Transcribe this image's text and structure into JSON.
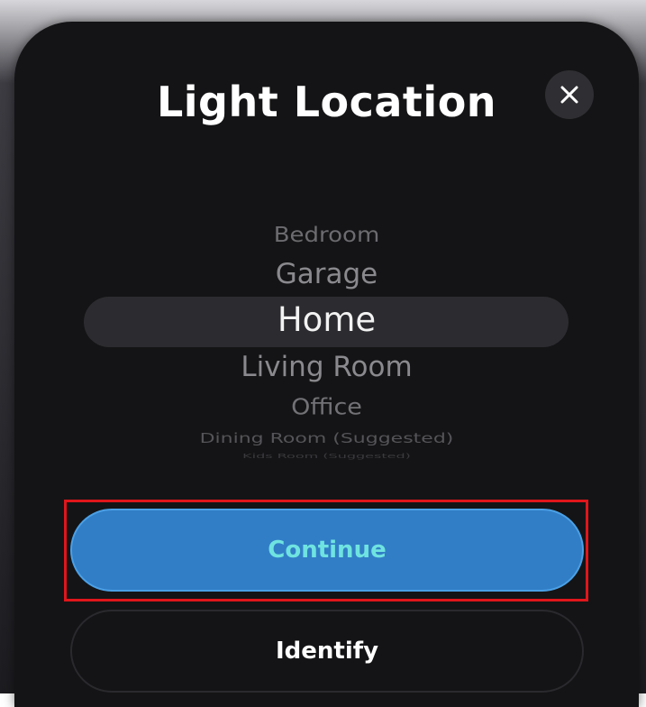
{
  "dialog": {
    "title": "Light Location",
    "close_icon": "close-icon"
  },
  "picker": {
    "items": [
      "Bedroom",
      "Garage",
      "Home",
      "Living Room",
      "Office",
      "Dining Room (Suggested)",
      "Kids Room (Suggested)"
    ],
    "selected": "Home"
  },
  "actions": {
    "continue_label": "Continue",
    "identify_label": "Identify"
  },
  "colors": {
    "sheet_background": "#141416",
    "continue_background": "#317ec6",
    "continue_text": "#6fe3e0",
    "highlight_outline": "#e0161b"
  }
}
